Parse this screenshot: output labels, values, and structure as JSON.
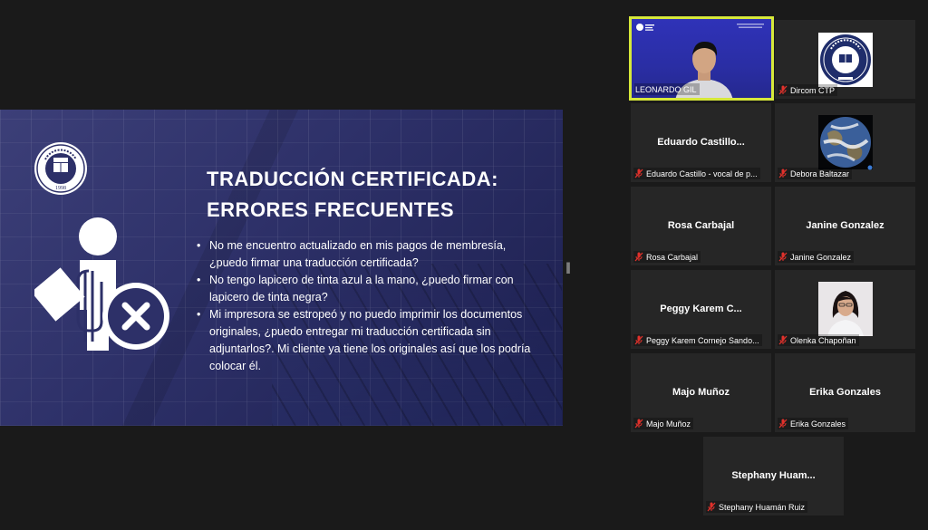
{
  "slide": {
    "title_line1": "TRADUCCIÓN CERTIFICADA:",
    "title_line2": "ERRORES FRECUENTES",
    "bullets": [
      "No me encuentro actualizado en mis pagos de membresía, ¿puedo firmar una traducción certificada?",
      "No tengo lapicero de tinta azul a la mano, ¿puedo firmar con lapicero de tinta negra?",
      "Mi impresora se estropeó y no puedo imprimir los documentos originales, ¿puedo entregar mi traducción certificada sin adjuntarlos?. Mi cliente ya tiene los originales así que los podría colocar él."
    ],
    "logo_year": "1998",
    "colors": {
      "accent_bg": "#2d3068",
      "text": "#ffffff"
    }
  },
  "splitter_glyph": "‖",
  "participants": [
    {
      "id": "leonardo",
      "label": "LEONARDO GIL",
      "kind": "video",
      "active": true,
      "muted": false
    },
    {
      "id": "dircom",
      "label": "Dircom CTP",
      "kind": "logo",
      "muted": true
    },
    {
      "id": "eduardo",
      "display_name": "Eduardo  Castillo...",
      "label": "Eduardo Castillo - vocal de p...",
      "kind": "name",
      "muted": true
    },
    {
      "id": "debora",
      "label": "Debora Baltazar",
      "kind": "earth",
      "muted": true
    },
    {
      "id": "rosa",
      "display_name": "Rosa Carbajal",
      "label": "Rosa Carbajal",
      "kind": "name",
      "muted": true
    },
    {
      "id": "janine",
      "display_name": "Janine Gonzalez",
      "label": "Janine Gonzalez",
      "kind": "name",
      "muted": true
    },
    {
      "id": "peggy",
      "display_name": "Peggy  Karem  C...",
      "label": "Peggy Karem Cornejo Sando...",
      "kind": "name",
      "muted": true
    },
    {
      "id": "olenka",
      "label": "Olenka Chapoñan",
      "kind": "photo",
      "muted": true
    },
    {
      "id": "majo",
      "display_name": "Majo Muñoz",
      "label": "Majo Muñoz",
      "kind": "name",
      "muted": true
    },
    {
      "id": "erika",
      "display_name": "Erika Gonzales",
      "label": "Erika Gonzales",
      "kind": "name",
      "muted": true
    },
    {
      "id": "stephany",
      "display_name": "Stephany  Huam...",
      "label": "Stephany Huamán Ruiz",
      "kind": "name",
      "muted": true
    }
  ],
  "icons": {
    "mute": "microphone-muted-icon"
  },
  "colors": {
    "active_border": "#d6e83a",
    "tile_bg": "#262626",
    "mute_red": "#e0312b",
    "page_bg": "#1a1a1a"
  }
}
